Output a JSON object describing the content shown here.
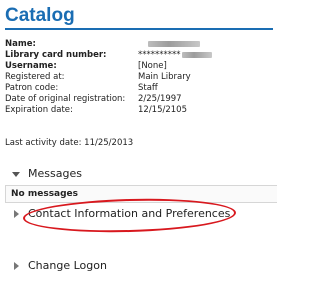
{
  "catalog": {
    "title": "Catalog"
  },
  "patron": {
    "rows": [
      {
        "label": "Name:",
        "value": "",
        "bold_label": true,
        "redacted": true
      },
      {
        "label": "Library card number:",
        "value": "**********",
        "bold_label": true,
        "redacted": true
      },
      {
        "label": "Username:",
        "value": "[None]",
        "bold_label": true,
        "redacted": false
      },
      {
        "label": "Registered at:",
        "value": "Main Library",
        "bold_label": false,
        "redacted": false
      },
      {
        "label": "Patron code:",
        "value": "Staff",
        "bold_label": false,
        "redacted": false
      },
      {
        "label": "Date of original registration:",
        "value": "2/25/1997",
        "bold_label": false,
        "redacted": false
      },
      {
        "label": "Expiration date:",
        "value": "12/15/2105",
        "bold_label": false,
        "redacted": false
      }
    ]
  },
  "last_activity": "Last activity date: 11/25/2013",
  "sections": {
    "messages": {
      "label": "Messages",
      "empty_text": "No messages",
      "expanded": true
    },
    "contact": {
      "label": "Contact Information and Preferences",
      "expanded": false
    },
    "logon": {
      "label": "Change Logon",
      "expanded": false
    }
  },
  "annotation": {
    "color": "#d8181e",
    "shape": "ellipse"
  },
  "colors": {
    "heading": "#1a6db3"
  }
}
